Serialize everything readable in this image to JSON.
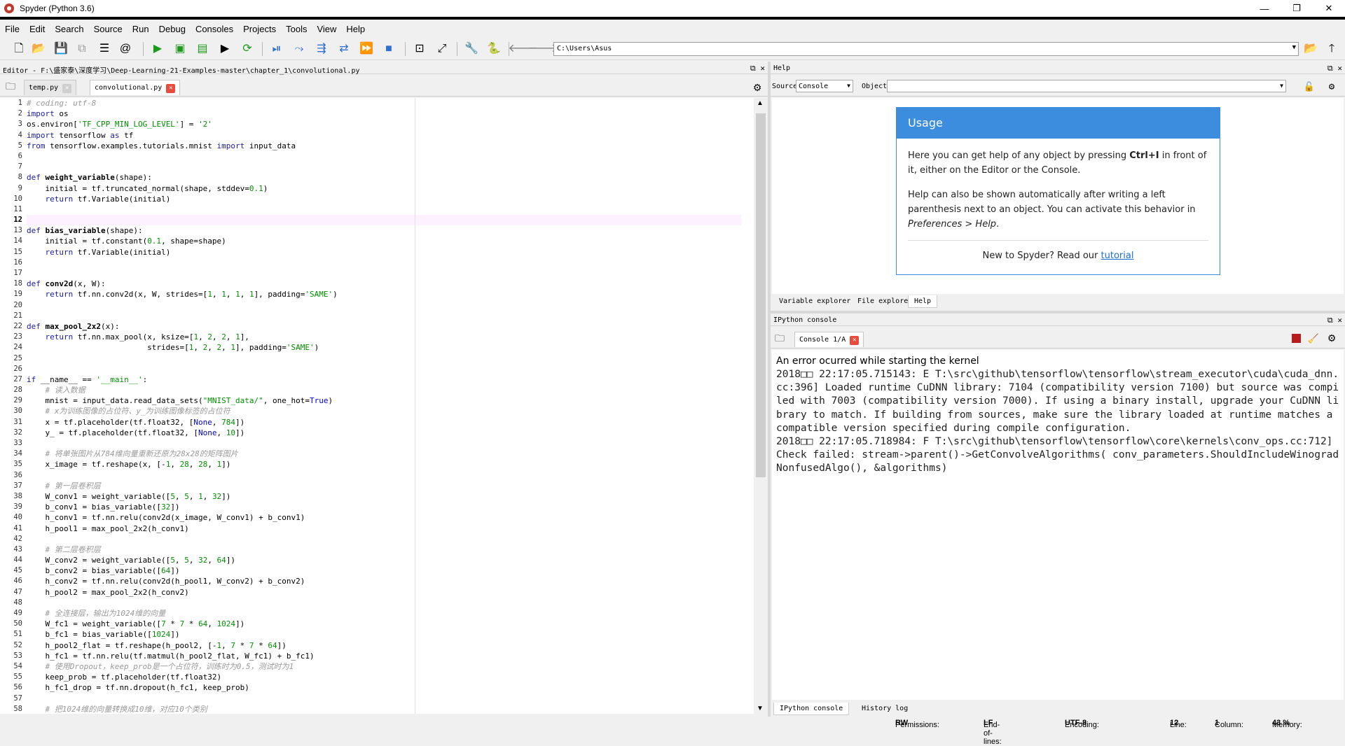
{
  "window": {
    "title": "Spyder (Python 3.6)",
    "minimize": "—",
    "maximize": "❐",
    "close": "✕"
  },
  "menu": [
    "File",
    "Edit",
    "Search",
    "Source",
    "Run",
    "Debug",
    "Consoles",
    "Projects",
    "Tools",
    "View",
    "Help"
  ],
  "toolbar": {
    "path": "C:\\Users\\Asus"
  },
  "editor": {
    "header": "Editor - F:\\盛家泰\\深度学习\\Deep-Learning-21-Examples-master\\chapter_1\\convolutional.py",
    "tabs": [
      {
        "label": "temp.py"
      },
      {
        "label": "convolutional.py"
      }
    ],
    "current_line": 12,
    "lines": [
      "# coding: utf-8",
      "import os",
      "os.environ['TF_CPP_MIN_LOG_LEVEL'] = '2'",
      "import tensorflow as tf",
      "from tensorflow.examples.tutorials.mnist import input_data",
      "",
      "",
      "def weight_variable(shape):",
      "    initial = tf.truncated_normal(shape, stddev=0.1)",
      "    return tf.Variable(initial)",
      "",
      "",
      "def bias_variable(shape):",
      "    initial = tf.constant(0.1, shape=shape)",
      "    return tf.Variable(initial)",
      "",
      "",
      "def conv2d(x, W):",
      "    return tf.nn.conv2d(x, W, strides=[1, 1, 1, 1], padding='SAME')",
      "",
      "",
      "def max_pool_2x2(x):",
      "    return tf.nn.max_pool(x, ksize=[1, 2, 2, 1],",
      "                          strides=[1, 2, 2, 1], padding='SAME')",
      "",
      "",
      "if __name__ == '__main__':",
      "    # 读入数据",
      "    mnist = input_data.read_data_sets(\"MNIST_data/\", one_hot=True)",
      "    # x为训练图像的占位符、y_为训练图像标签的占位符",
      "    x = tf.placeholder(tf.float32, [None, 784])",
      "    y_ = tf.placeholder(tf.float32, [None, 10])",
      "",
      "    # 将单张图片从784维向量重新还原为28x28的矩阵图片",
      "    x_image = tf.reshape(x, [-1, 28, 28, 1])",
      "",
      "    # 第一层卷积层",
      "    W_conv1 = weight_variable([5, 5, 1, 32])",
      "    b_conv1 = bias_variable([32])",
      "    h_conv1 = tf.nn.relu(conv2d(x_image, W_conv1) + b_conv1)",
      "    h_pool1 = max_pool_2x2(h_conv1)",
      "",
      "    # 第二层卷积层",
      "    W_conv2 = weight_variable([5, 5, 32, 64])",
      "    b_conv2 = bias_variable([64])",
      "    h_conv2 = tf.nn.relu(conv2d(h_pool1, W_conv2) + b_conv2)",
      "    h_pool2 = max_pool_2x2(h_conv2)",
      "",
      "    # 全连接层，输出为1024维的向量",
      "    W_fc1 = weight_variable([7 * 7 * 64, 1024])",
      "    b_fc1 = bias_variable([1024])",
      "    h_pool2_flat = tf.reshape(h_pool2, [-1, 7 * 7 * 64])",
      "    h_fc1 = tf.nn.relu(tf.matmul(h_pool2_flat, W_fc1) + b_fc1)",
      "    # 使用Dropout，keep_prob是一个占位符，训练时为0.5，测试时为1",
      "    keep_prob = tf.placeholder(tf.float32)",
      "    h_fc1_drop = tf.nn.dropout(h_fc1, keep_prob)",
      "",
      "    # 把1024维的向量转换成10维，对应10个类别"
    ]
  },
  "help": {
    "header": "Help",
    "source_label": "Source",
    "source_value": "Console",
    "object_label": "Object",
    "usage_title": "Usage",
    "usage_p1_a": "Here you can get help of any object by pressing ",
    "usage_p1_b": "Ctrl+I",
    "usage_p1_c": " in front of it, either on the Editor or the Console.",
    "usage_p2_a": "Help can also be shown automatically after writing a left parenthesis next to an object. You can activate this behavior in ",
    "usage_p2_b": "Preferences > Help",
    "usage_p2_c": ".",
    "usage_foot": "New to Spyder? Read our ",
    "usage_link": "tutorial",
    "tabs": [
      "Variable explorer",
      "File explorer",
      "Help"
    ]
  },
  "console": {
    "header": "IPython console",
    "tab_label": "Console 1/A",
    "error_head": "An error ocurred while starting the kernel",
    "output": "2018□□ 22:17:05.715143: E T:\\src\\github\\tensorflow\\tensorflow\\stream_executor\\cuda\\cuda_dnn.cc:396] Loaded runtime CuDNN library: 7104 (compatibility version 7100) but source was compiled with 7003 (compatibility version 7000). If using a binary install, upgrade your CuDNN library to match. If building from sources, make sure the library loaded at runtime matches a compatible version specified during compile configuration.\n2018□□ 22:17:05.718984: F T:\\src\\github\\tensorflow\\tensorflow\\core\\kernels\\conv_ops.cc:712] Check failed: stream->parent()->GetConvolveAlgorithms( conv_parameters.ShouldIncludeWinogradNonfusedAlgo(), &algorithms)",
    "bottom_tabs": [
      "IPython console",
      "History log"
    ]
  },
  "status": {
    "permissions_label": "Permissions:",
    "permissions": "RW",
    "eol_label": "End-of-lines:",
    "eol": "LF",
    "encoding_label": "Encoding:",
    "encoding": "UTF-8",
    "line_label": "Line:",
    "line": "12",
    "column_label": "Column:",
    "column": "1",
    "memory_label": "Memory:",
    "memory": "43 %"
  }
}
